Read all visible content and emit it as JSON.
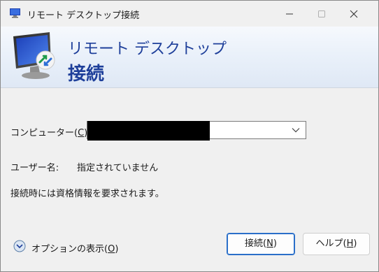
{
  "window": {
    "title": "リモート デスクトップ接続"
  },
  "banner": {
    "line1": "リモート デスクトップ",
    "line2": "接続"
  },
  "form": {
    "computer_label_prefix": "コンピューター(",
    "computer_label_key": "C",
    "computer_label_suffix": "):",
    "username_label": "ユーザー名:",
    "username_value": "指定されていません",
    "credential_note": "接続時には資格情報を要求されます。"
  },
  "options": {
    "label_prefix": "オプションの表示(",
    "label_key": "O",
    "label_suffix": ")"
  },
  "buttons": {
    "connect_prefix": "接続(",
    "connect_key": "N",
    "connect_suffix": ")",
    "help_prefix": "ヘルプ(",
    "help_key": "H",
    "help_suffix": ")"
  },
  "colors": {
    "banner_text": "#1e3f9a",
    "accent": "#2a6fc9"
  }
}
